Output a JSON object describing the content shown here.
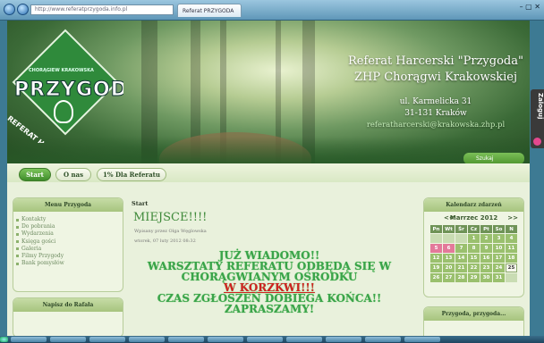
{
  "browser": {
    "url": "http://www.referatprzygoda.info.pl",
    "tab_title": "Referat PRZYGODA",
    "window_buttons": "– ▢ ✕"
  },
  "header": {
    "title_line1": "Referat Harcerski \"Przygoda\"",
    "title_line2": "ZHP Chorągwi Krakowskiej",
    "address_line1": "ul. Karmelicka 31",
    "address_line2": "31-131 Kraków",
    "email": "referatharcerski@krakowska.zhp.pl",
    "logo_wordmark": "PRZYGODA",
    "logo_arc": "CHORĄGIEW KRAKOWSKA",
    "logo_diagonal": "REFERAT HARCERSKI",
    "login_tab": "Zaloguj",
    "search_label": "Szukaj"
  },
  "nav": {
    "items": [
      {
        "label": "Start",
        "active": true
      },
      {
        "label": "O nas",
        "active": false
      },
      {
        "label": "1% Dla Referatu",
        "active": false
      }
    ]
  },
  "sidebar_left": {
    "menu_title": "Menu Przygoda",
    "menu_items": [
      "Kontakty",
      "Do pobrania",
      "Wydarzenia",
      "Księga gości",
      "Galeria",
      "Filmy Przygody",
      "Bank pomysłów"
    ],
    "box2_title": "Napisz do Rafała"
  },
  "content": {
    "breadcrumb": "Start",
    "post_title": "MIEJSCE!!!!",
    "author_line": "Wpisany przez Olga Węglowska",
    "date_line": "wtorek, 07 luty 2012 08:32",
    "announce_line1": "JUŻ WIADOMO!!",
    "announce_line2": "WARSZTATY REFERATU ODBĘDĄ SIĘ W",
    "announce_line3": "CHORĄGWIANYM OŚRODKU",
    "announce_line4": "W KORZKWI!!!",
    "announce_line5": "CZAS ZGŁOSZEŃ DOBIEGA KOŃCA!!",
    "announce_line6": "ZAPRASZAMY!"
  },
  "sidebar_right": {
    "calendar_title": "Kalendarz zdarzeń",
    "month_label": "Marrzec 2012",
    "prev": "<<",
    "next": ">>",
    "weekdays": [
      "Pn",
      "Wt",
      "Śr",
      "Cz",
      "Pt",
      "So",
      "N"
    ],
    "weeks": [
      [
        "",
        "",
        "",
        "1",
        "2",
        "3",
        "4"
      ],
      [
        "5",
        "6",
        "7",
        "8",
        "9",
        "10",
        "11"
      ],
      [
        "12",
        "13",
        "14",
        "15",
        "16",
        "17",
        "18"
      ],
      [
        "19",
        "20",
        "21",
        "22",
        "23",
        "24",
        "25"
      ],
      [
        "26",
        "27",
        "28",
        "29",
        "30",
        "31",
        ""
      ]
    ],
    "today": "25",
    "highlight": [
      "5",
      "6"
    ],
    "box2_title": "Przygoda, przygoda..."
  },
  "colors": {
    "accent_green": "#4f962f",
    "announce_green": "#3aa34a",
    "announce_red": "#d02020",
    "calendar_cell": "#9ac06e",
    "calendar_highlight": "#e3799a"
  }
}
